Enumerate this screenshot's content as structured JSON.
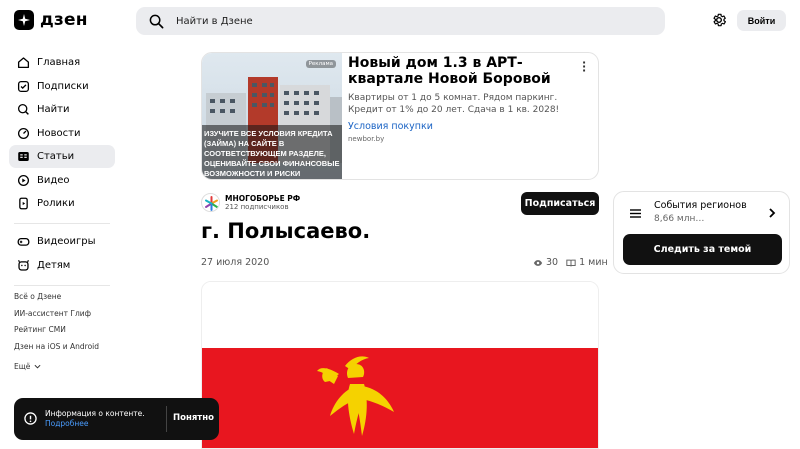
{
  "header": {
    "logo_text": "дзен",
    "search_placeholder": "Найти в Дзене",
    "login_label": "Войти"
  },
  "sidebar": {
    "items": [
      {
        "label": "Главная",
        "icon": "home-icon"
      },
      {
        "label": "Подписки",
        "icon": "subscriptions-icon"
      },
      {
        "label": "Найти",
        "icon": "search-icon"
      },
      {
        "label": "Новости",
        "icon": "news-icon"
      },
      {
        "label": "Статьи",
        "icon": "articles-icon",
        "active": true
      },
      {
        "label": "Видео",
        "icon": "video-icon"
      },
      {
        "label": "Ролики",
        "icon": "shorts-icon"
      }
    ],
    "items2": [
      {
        "label": "Видеоигры",
        "icon": "gamepad-icon"
      },
      {
        "label": "Детям",
        "icon": "kids-icon"
      }
    ],
    "footer": [
      "Всё о Дзене",
      "ИИ-ассистент Глиф",
      "Рейтинг СМИ",
      "Дзен на iOS и Android",
      "Ещё"
    ]
  },
  "ad": {
    "badge": "Реклама",
    "title": "Новый дом 1.3 в АРТ-квартале Новой Боровой",
    "description": "Квартиры от 1 до 5 комнат. Рядом паркинг. Кредит от 1% до 20 лет. Сдача в 1 кв. 2028!",
    "link": "Условия покупки",
    "domain": "newbor.by",
    "image_text": "ИЗУЧИТЕ ВСЕ УСЛОВИЯ КРЕДИТА (ЗАЙМА) НА САЙТЕ В СООТВЕТСТВУЮЩЕМ РАЗДЕЛЕ, ОЦЕНИВАЙТЕ СВОИ ФИНАНСОВЫЕ ВОЗМОЖНОСТИ И РИСКИ"
  },
  "channel": {
    "name": "МНОГОБОРЬЕ РФ",
    "subscribers": "212 подписчиков",
    "subscribe_label": "Подписаться"
  },
  "article": {
    "title": "г. Полысаево.",
    "date": "27 июля 2020",
    "views": "30",
    "read_time": "1 мин"
  },
  "topic": {
    "name": "События регионов",
    "count": "8,66 млн…",
    "follow_label": "Следить за темой"
  },
  "toast": {
    "text": "Информация о контенте.",
    "link": "Подробнее",
    "button": "Понятно"
  },
  "colors": {
    "flag_red": "#e8161f",
    "flag_yellow": "#f5d200",
    "link_blue": "#1a63c4",
    "accent_dark": "#111111"
  }
}
